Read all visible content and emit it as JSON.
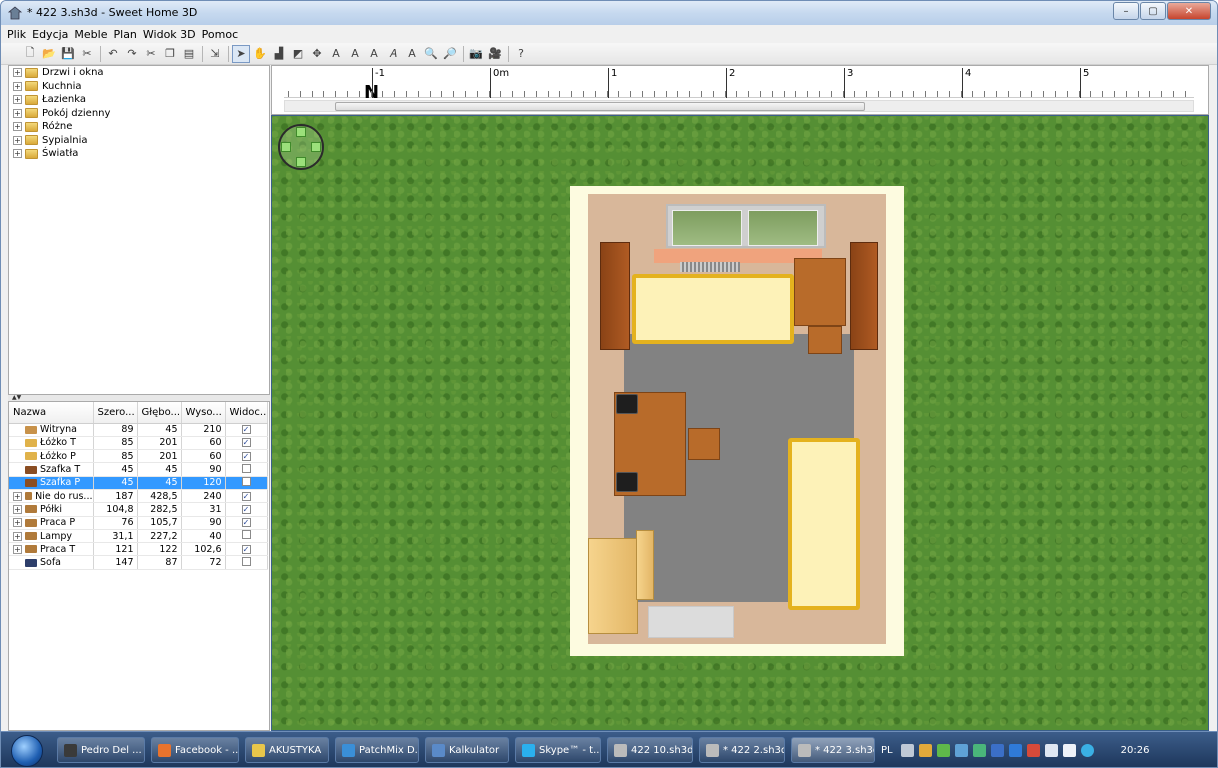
{
  "window": {
    "title": "* 422 3.sh3d - Sweet Home 3D",
    "minimize": "–",
    "maximize": "▢",
    "close": "✕"
  },
  "menu": [
    "Plik",
    "Edycja",
    "Meble",
    "Plan",
    "Widok 3D",
    "Pomoc"
  ],
  "catalog": {
    "items": [
      "Drzwi i okna",
      "Kuchnia",
      "Łazienka",
      "Pokój dzienny",
      "Różne",
      "Sypialnia",
      "Światła"
    ]
  },
  "furniture_table": {
    "headers": [
      "Nazwa",
      "Szero...",
      "Głębo...",
      "Wyso...",
      "Widoc..."
    ],
    "rows": [
      {
        "name": "Witryna",
        "w": "89",
        "d": "45",
        "h": "210",
        "visible": true,
        "group": false,
        "color": "#c8924a"
      },
      {
        "name": "Łóżko T",
        "w": "85",
        "d": "201",
        "h": "60",
        "visible": true,
        "group": false,
        "color": "#e0b24a"
      },
      {
        "name": "Łóżko P",
        "w": "85",
        "d": "201",
        "h": "60",
        "visible": true,
        "group": false,
        "color": "#e0b24a"
      },
      {
        "name": "Szafka T",
        "w": "45",
        "d": "45",
        "h": "90",
        "visible": false,
        "group": false,
        "color": "#8a4d22"
      },
      {
        "name": "Szafka P",
        "w": "45",
        "d": "45",
        "h": "120",
        "visible": false,
        "group": false,
        "color": "#8a4d22",
        "selected": true
      },
      {
        "name": "Nie do rus...",
        "w": "187",
        "d": "428,5",
        "h": "240",
        "visible": true,
        "group": true,
        "color": "#b07a3a"
      },
      {
        "name": "Półki",
        "w": "104,8",
        "d": "282,5",
        "h": "31",
        "visible": true,
        "group": true,
        "color": "#b07a3a"
      },
      {
        "name": "Praca P",
        "w": "76",
        "d": "105,7",
        "h": "90",
        "visible": true,
        "group": true,
        "color": "#b07a3a"
      },
      {
        "name": "Lampy",
        "w": "31,1",
        "d": "227,2",
        "h": "40",
        "visible": false,
        "group": true,
        "color": "#b07a3a"
      },
      {
        "name": "Praca T",
        "w": "121",
        "d": "122",
        "h": "102,6",
        "visible": true,
        "group": true,
        "color": "#b07a3a"
      },
      {
        "name": "Sofa",
        "w": "147",
        "d": "87",
        "h": "72",
        "visible": false,
        "group": false,
        "color": "#2d3e6a"
      }
    ]
  },
  "ruler": {
    "labels": [
      "-1",
      "0m",
      "1",
      "2",
      "3",
      "4",
      "5"
    ],
    "north": "N",
    "scroll_mark": "III"
  },
  "taskbar": {
    "tasks": [
      {
        "label": "Pedro Del ...",
        "color": "#3a3a3a"
      },
      {
        "label": "Facebook - ...",
        "color": "#e8732d"
      },
      {
        "label": "AKUSTYKA",
        "color": "#e8c64a"
      },
      {
        "label": "PatchMix D...",
        "color": "#3a8fd8"
      },
      {
        "label": "Kalkulator",
        "color": "#5a8ac8"
      },
      {
        "label": "Skype™ - t...",
        "color": "#2ab0ee"
      },
      {
        "label": "422 10.sh3d...",
        "color": "#bbbbbb"
      },
      {
        "label": "* 422 2.sh3d...",
        "color": "#bbbbbb"
      },
      {
        "label": "* 422 3.sh3d...",
        "color": "#bbbbbb",
        "active": true
      }
    ],
    "language": "PL",
    "clock": "20:26"
  }
}
